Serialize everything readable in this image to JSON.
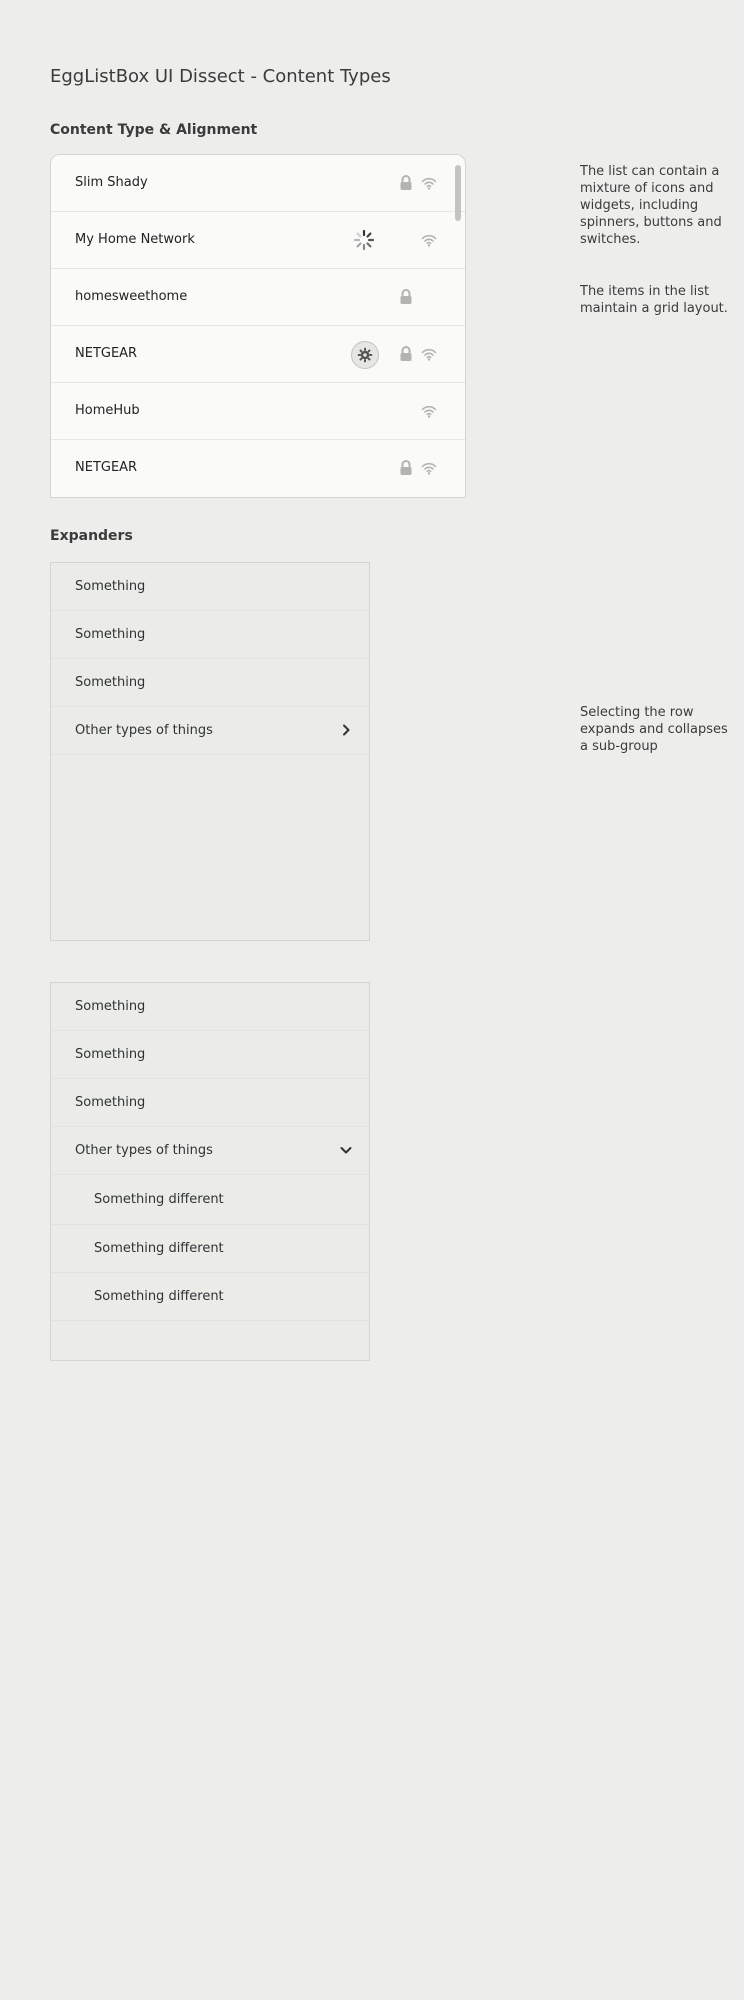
{
  "page": {
    "title": "EggListBox UI Dissect - Content Types"
  },
  "content_section": {
    "heading": "Content Type & Alignment",
    "rows": [
      {
        "label": "Slim Shady",
        "icons": [
          "lock-icon",
          "wifi-icon"
        ]
      },
      {
        "label": "My Home Network",
        "icons": [
          "spinner-icon",
          "wifi-icon"
        ]
      },
      {
        "label": "homesweethome",
        "icons": [
          "lock-icon"
        ]
      },
      {
        "label": "NETGEAR",
        "icons": [
          "gear-button",
          "lock-icon",
          "wifi-icon"
        ]
      },
      {
        "label": "HomeHub",
        "icons": [
          "wifi-icon"
        ]
      },
      {
        "label": "NETGEAR",
        "icons": [
          "lock-icon",
          "wifi-icon"
        ]
      }
    ],
    "notes": [
      "The list can contain a mixture of icons and widgets, including spinners, buttons and switches.",
      "The items in the list maintain a grid layout."
    ]
  },
  "expanders_section": {
    "heading": "Expanders",
    "collapsed": {
      "rows": [
        "Something",
        "Something",
        "Something"
      ],
      "expander_label": "Other types of things",
      "expander_icon": "chevron-right-icon"
    },
    "expanded": {
      "rows": [
        "Something",
        "Something",
        "Something"
      ],
      "expander_label": "Other types of things",
      "expander_icon": "chevron-down-icon",
      "sub_rows": [
        "Something different",
        "Something different",
        "Something different"
      ]
    },
    "note": "Selecting the row expands and collapses a sub-group"
  },
  "colors": {
    "background": "#ededeb",
    "list_background": "#fafaf9",
    "expander_background": "#ebebe8",
    "icon_grey": "#b3b3b0"
  }
}
